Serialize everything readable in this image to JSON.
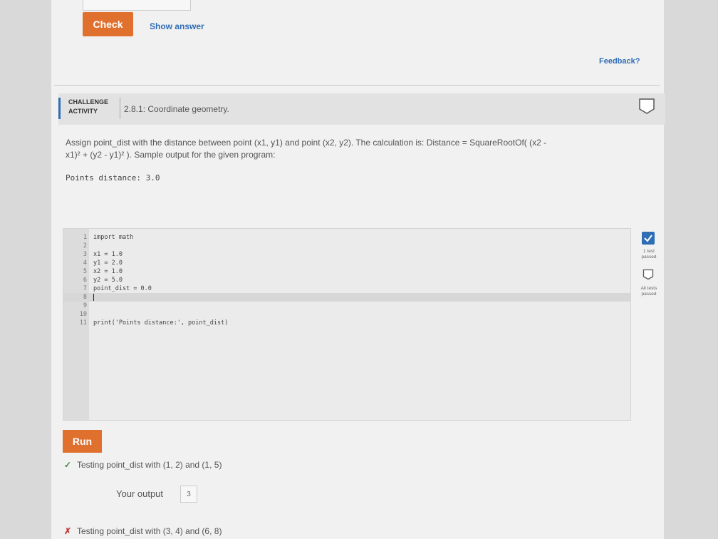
{
  "top": {
    "check_label": "Check",
    "show_answer_label": "Show answer",
    "feedback_label": "Feedback?"
  },
  "challenge": {
    "tag_line1": "CHALLENGE",
    "tag_line2": "ACTIVITY",
    "title": "2.8.1: Coordinate geometry.",
    "description_line1": "Assign point_dist with the distance between point (x1, y1) and point (x2, y2). The calculation is: Distance = SquareRootOf( (x2 -",
    "description_line2": "x1)² + (y2 - y1)² ). Sample output for the given program:",
    "sample_output": "Points distance: 3.0"
  },
  "editor": {
    "lines": [
      {
        "n": "1",
        "code": "import math"
      },
      {
        "n": "2",
        "code": ""
      },
      {
        "n": "3",
        "code": "x1 = 1.0"
      },
      {
        "n": "4",
        "code": "y1 = 2.0"
      },
      {
        "n": "5",
        "code": "x2 = 1.0"
      },
      {
        "n": "6",
        "code": "y2 = 5.0"
      },
      {
        "n": "7",
        "code": "point_dist = 0.0"
      },
      {
        "n": "8",
        "code": ""
      },
      {
        "n": "9",
        "code": ""
      },
      {
        "n": "10",
        "code": ""
      },
      {
        "n": "11",
        "code": "print('Points distance:', point_dist)"
      }
    ]
  },
  "status": {
    "one_test_line1": "1 test",
    "one_test_line2": "passed",
    "all_tests_line1": "All tests",
    "all_tests_line2": "passed"
  },
  "results": {
    "run_label": "Run",
    "test1": "Testing point_dist with (1, 2) and (1, 5)",
    "your_output_label": "Your output",
    "your_output_value": "3",
    "test2": "Testing point_dist with (3, 4) and (6, 8)"
  },
  "colors": {
    "accent": "#e0702d",
    "link": "#2f6db5",
    "pass": "#3c8a3c",
    "fail": "#c43a3a"
  }
}
